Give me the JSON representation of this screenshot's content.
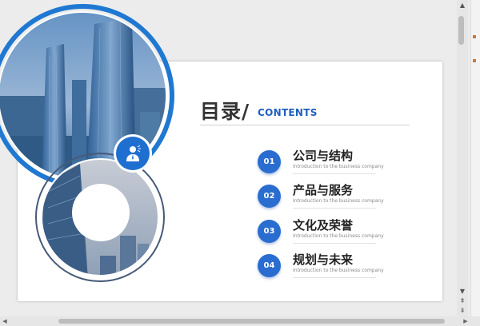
{
  "slide": {
    "title_cn": "目录/",
    "title_en": "CONTENTS",
    "items": [
      {
        "number": "01",
        "title": "公司与结构",
        "subtitle": "Introduction to the business company"
      },
      {
        "number": "02",
        "title": "产品与服务",
        "subtitle": "Introduction to the business company"
      },
      {
        "number": "03",
        "title": "文化及荣誉",
        "subtitle": "Introduction to the business company"
      },
      {
        "number": "04",
        "title": "规划与未来",
        "subtitle": "Introduction to the business company"
      }
    ]
  },
  "icons": {
    "person": "person-icon",
    "scroll_up": "scroll-up-icon",
    "scroll_down": "scroll-down-icon",
    "page_up": "page-up-icon",
    "page_down": "page-down-icon",
    "scroll_left": "scroll-left-icon",
    "scroll_right": "scroll-right-icon"
  },
  "colors": {
    "accent": "#2a6dd0",
    "title_en": "#1f5fbf",
    "title_cn": "#333333"
  }
}
